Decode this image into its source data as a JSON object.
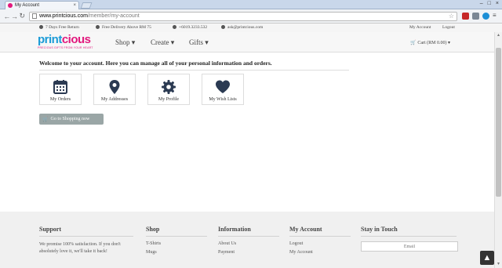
{
  "browser": {
    "tab_title": "My Account",
    "tab_close": "×",
    "window_controls": [
      "–",
      "□",
      "×"
    ],
    "back": "←",
    "forward": "→",
    "reload": "↻",
    "url_host": "www.printcious.com",
    "url_path": "/member/my-account",
    "star": "☆",
    "menu_icon": "≡"
  },
  "infobar": {
    "return_text": "7 Days Free Return",
    "delivery_text": "Free Delivery Above RM 75",
    "phone_text": "+6019.3233.532",
    "email_text": "ask@printcious.com",
    "my_account": "My Account",
    "logout": "Logout"
  },
  "nav": {
    "logo_part1": "print",
    "logo_part2": "cious",
    "logo_tagline": "PRECIOUS GIFTS FROM YOUR HEART",
    "shop": "Shop ▾",
    "create": "Create ▾",
    "gifts": "Gifts ▾",
    "cart": "Cart (RM 0.00) ▾"
  },
  "main": {
    "welcome": "Welcome to your account. Here you can manage all of your personal information and orders.",
    "cards": [
      "My Orders",
      "My Addresses",
      "My Profile",
      "My Wish Lists"
    ],
    "shop_button": "Go to Shopping now"
  },
  "footer": {
    "support_title": "Support",
    "support_text": "We promise 100% satisfaction. If you don't absolutely love it, we'll take it back!",
    "shop_title": "Shop",
    "shop_links": [
      "T-Shirts",
      "Mugs"
    ],
    "info_title": "Information",
    "info_links": [
      "About Us",
      "Payment"
    ],
    "account_title": "My Account",
    "account_links": [
      "Logout",
      "My Account"
    ],
    "stay_title": "Stay in Touch",
    "email_placeholder": "Email",
    "to_top": "▲"
  },
  "colors": {
    "brand_blue": "#1b9bd7",
    "brand_pink": "#e2187d",
    "icon_navy": "#2b3a52",
    "button_gray": "#9aa6a6"
  }
}
